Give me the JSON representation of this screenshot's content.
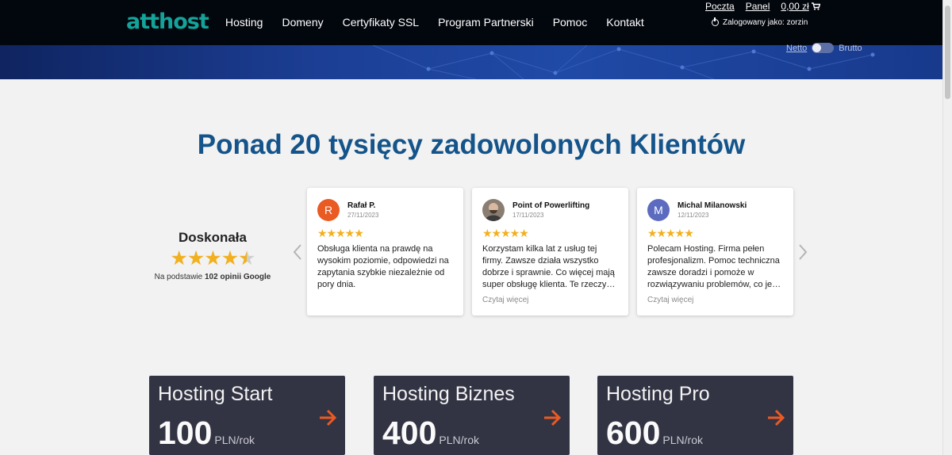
{
  "header": {
    "logo": "atthost",
    "nav": [
      "Hosting",
      "Domeny",
      "Certyfikaty SSL",
      "Program Partnerski",
      "Pomoc",
      "Kontakt"
    ],
    "links": {
      "mail": "Poczta",
      "panel": "Panel",
      "cart": "0,00 zł"
    },
    "logged_in": "Zalogowany jako: zorzin"
  },
  "vat_toggle": {
    "netto": "Netto",
    "brutto": "Brutto"
  },
  "heading": "Ponad 20 tysięcy zadowolonych Klientów",
  "rating": {
    "label": "Doskonała",
    "score_fraction": 0.9,
    "basis_prefix": "Na podstawie",
    "basis_count": "102 opinii Google"
  },
  "reviews": [
    {
      "initial": "R",
      "avatar_color": "#ea5a23",
      "name": "Rafał P.",
      "date": "27/11/2023",
      "stars": "★★★★★",
      "text": "Obsługa klienta na prawdę na wysokim poziomie, odpowiedzi na zapytania szybkie niezależnie od pory dnia.",
      "more": ""
    },
    {
      "initial": "",
      "avatar_color": "#6b5a4e",
      "name": "Point of Powerlifting",
      "date": "17/11/2023",
      "stars": "★★★★★",
      "text": "Korzystam kilka lat z usług tej firmy. Zawsze działa wszystko dobrze i sprawnie. Co więcej mają super obsługę klienta. Te rzeczy…",
      "more": "Czytaj więcej"
    },
    {
      "initial": "M",
      "avatar_color": "#5c6bc0",
      "name": "Michal Milanowski",
      "date": "12/11/2023",
      "stars": "★★★★★",
      "text": "Polecam Hosting. Firma pełen profesjonalizm. Pomoc techniczna zawsze doradzi i pomoże w rozwiązywaniu problemów, co je…",
      "more": "Czytaj więcej"
    }
  ],
  "plans": [
    {
      "name": "Hosting Start",
      "price": "100",
      "unit": "PLN/rok"
    },
    {
      "name": "Hosting Biznes",
      "price": "400",
      "unit": "PLN/rok"
    },
    {
      "name": "Hosting Pro",
      "price": "600",
      "unit": "PLN/rok"
    }
  ],
  "colors": {
    "brand": "#14a39a",
    "heading": "#14548a",
    "star": "#f2b01e",
    "plan_bg": "#323444",
    "plan_arrow": "#ea5a23"
  }
}
